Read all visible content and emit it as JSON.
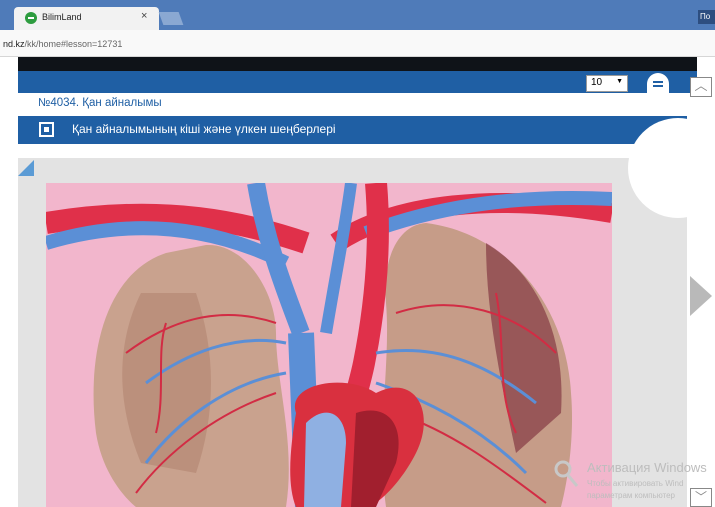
{
  "browser": {
    "tab_title": "BilimLand",
    "tab_close": "×",
    "corner_label": "По",
    "url_host": "nd.kz",
    "url_path": "/kk/home#lesson=12731"
  },
  "header": {
    "page_select_value": "10",
    "page_select_arrow": "▼",
    "up_symbol": "︿"
  },
  "lesson": {
    "title": "№4034. Қан айналымы",
    "topic": "Қан айналымының кіші және үлкен шеңберлері"
  },
  "content": {
    "illustration": "lungs-heart-circulation-illustration",
    "next_icon": "chevron-right-icon"
  },
  "watermark": {
    "title": "Активация Windows",
    "line1": "Чтобы активировать Wind",
    "line2": "параметрам компьютер"
  },
  "footer": {
    "down_symbol": "﹀"
  },
  "colors": {
    "brand_blue": "#1f5fa4",
    "tab_bar": "#4f7bb9",
    "artery_red": "#e0304a",
    "vein_blue": "#5b8fd6",
    "illustration_bg": "#f2b6cc"
  }
}
